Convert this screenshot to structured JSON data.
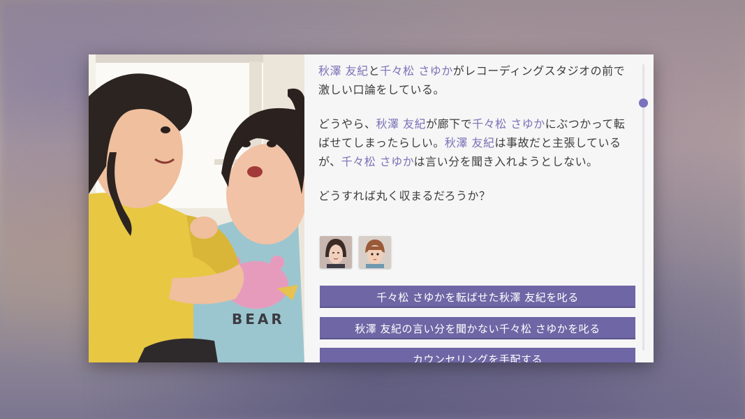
{
  "story": {
    "paragraphs": [
      [
        {
          "t": "秋澤 友紀",
          "n": true
        },
        {
          "t": "と",
          "n": false
        },
        {
          "t": "千々松 さゆか",
          "n": true
        },
        {
          "t": "がレコーディングスタジオの前で激しい口論をしている。",
          "n": false
        }
      ],
      [
        {
          "t": "どうやら、",
          "n": false
        },
        {
          "t": "秋澤 友紀",
          "n": true
        },
        {
          "t": "が廊下で",
          "n": false
        },
        {
          "t": "千々松 さゆか",
          "n": true
        },
        {
          "t": "にぶつかって転ばせてしまったらしい。",
          "n": false
        },
        {
          "t": "秋澤 友紀",
          "n": true
        },
        {
          "t": "は事故だと主張しているが、",
          "n": false
        },
        {
          "t": "千々松 さゆか",
          "n": true
        },
        {
          "t": "は言い分を聞き入れようとしない。",
          "n": false
        }
      ],
      [
        {
          "t": "どうすれば丸く収まるだろうか？",
          "n": false
        }
      ]
    ]
  },
  "choices": [
    {
      "label": "千々松 さゆかを転ばせた秋澤 友紀を叱る"
    },
    {
      "label": "秋澤 友紀の言い分を聞かない千々松 さゆかを叱る"
    },
    {
      "label": "カウンセリングを手配する"
    }
  ],
  "avatars": [
    {
      "icon": "character-portrait-akizawa-yuki"
    },
    {
      "icon": "character-portrait-chijimatsu-sayuka"
    }
  ],
  "colors": {
    "name_accent": "#7b72b8",
    "choice_bg": "#6e66a5",
    "panel_bg": "#f6f6f6"
  }
}
